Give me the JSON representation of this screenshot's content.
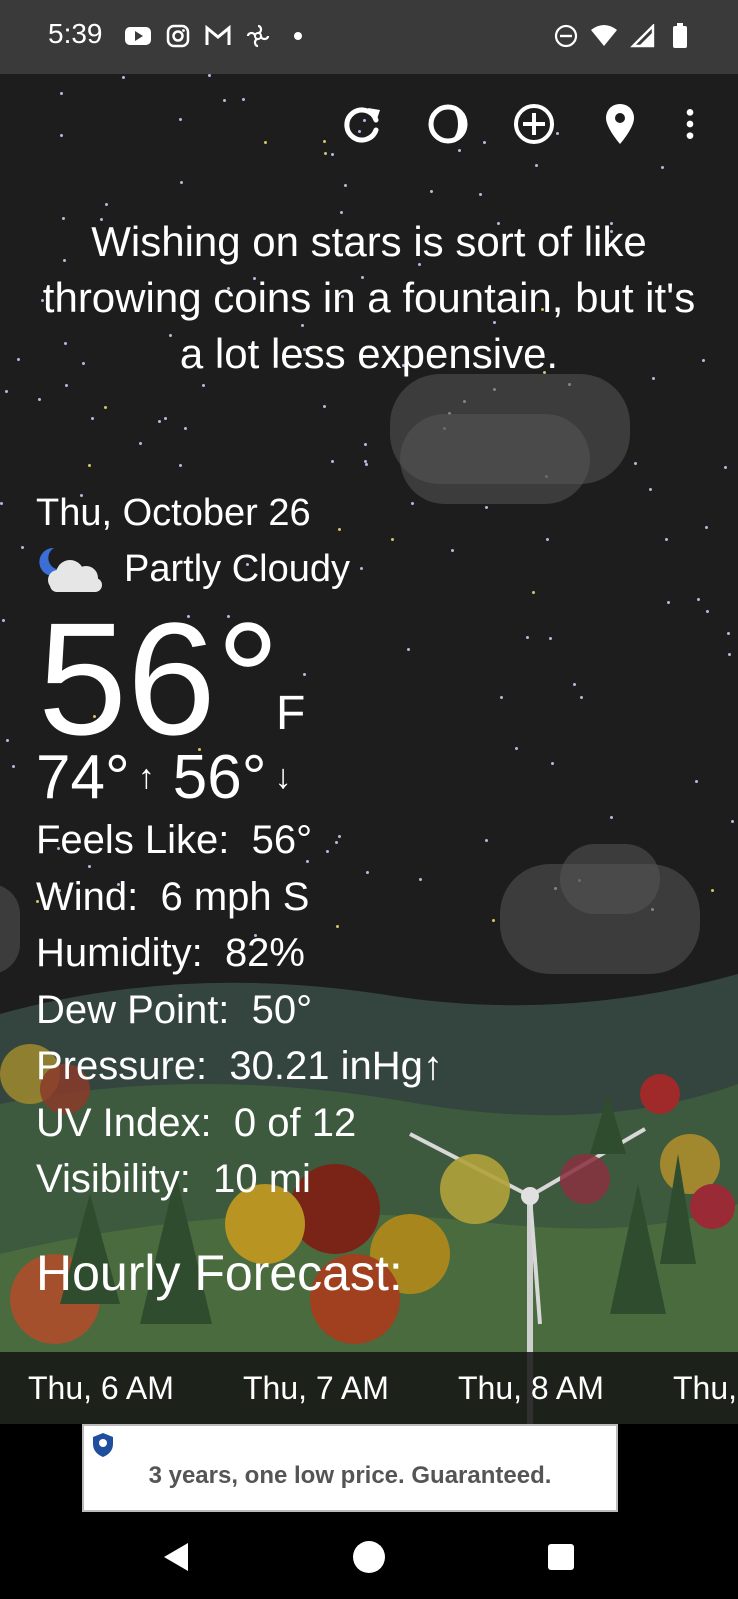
{
  "status": {
    "time": "5:39",
    "left_icons": [
      "youtube-icon",
      "instagram-icon",
      "gmail-icon",
      "pinwheel-icon",
      "dot-icon"
    ],
    "right_icons": [
      "dnd-icon",
      "wifi-icon",
      "signal-icon",
      "battery-icon"
    ]
  },
  "toolbar": {
    "icons": [
      "refresh-icon",
      "moon-phase-icon",
      "add-location-icon",
      "location-pin-icon",
      "overflow-menu-icon"
    ]
  },
  "quote": "Wishing on stars is sort of like throwing coins in a fountain, but it's a lot less expensive.",
  "weather": {
    "date": "Thu, October 26",
    "condition": "Partly Cloudy",
    "condition_icon": "partly-cloudy-night-icon",
    "temperature": "56°",
    "unit": "F",
    "high": "74°",
    "low": "56°",
    "details": [
      {
        "label": "Feels Like:",
        "value": "56°"
      },
      {
        "label": "Wind:",
        "value": "6 mph S"
      },
      {
        "label": "Humidity:",
        "value": "82%"
      },
      {
        "label": "Dew Point:",
        "value": "50°"
      },
      {
        "label": "Pressure:",
        "value": "30.21 inHg↑"
      },
      {
        "label": "UV Index:",
        "value": "0 of 12"
      },
      {
        "label": "Visibility:",
        "value": "10 mi"
      }
    ]
  },
  "hourly": {
    "title": "Hourly Forecast:",
    "items": [
      "Thu, 6 AM",
      "Thu, 7 AM",
      "Thu, 8 AM",
      "Thu,"
    ]
  },
  "ad": {
    "text": "3 years, one low price. Guaranteed."
  },
  "colors": {
    "background": "#1d1d1d",
    "statusbar": "#3a3a3a",
    "hills": "#3f5a4a",
    "text": "#ffffff"
  }
}
